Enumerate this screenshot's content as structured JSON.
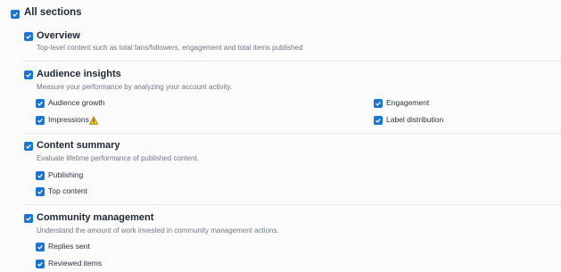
{
  "all_sections": {
    "label": "All sections",
    "checked": true
  },
  "sections": [
    {
      "title": "Overview",
      "description": "Top-level content such as total fans/followers, engagement and total items published",
      "checked": true,
      "items": []
    },
    {
      "title": "Audience insights",
      "description": "Measure your performance by analyzing your account activity.",
      "checked": true,
      "items": [
        {
          "label": "Audience growth",
          "checked": true
        },
        {
          "label": "Impressions",
          "checked": true,
          "icon": "warning-icon"
        },
        {
          "label": "Engagement",
          "checked": true
        },
        {
          "label": "Label distribution",
          "checked": true
        }
      ]
    },
    {
      "title": "Content summary",
      "description": "Evaluate lifetime performance of published content.",
      "checked": true,
      "items": [
        {
          "label": "Publishing",
          "checked": true
        },
        {
          "label": "Top content",
          "checked": true
        }
      ]
    },
    {
      "title": "Community management",
      "description": "Understand the amount of work invested in community management actions.",
      "checked": true,
      "items": [
        {
          "label": "Replies sent",
          "checked": true
        },
        {
          "label": "Reviewed items",
          "checked": true
        }
      ]
    }
  ],
  "colors": {
    "checkbox": "#1976d2",
    "warning": "#f5c518"
  }
}
